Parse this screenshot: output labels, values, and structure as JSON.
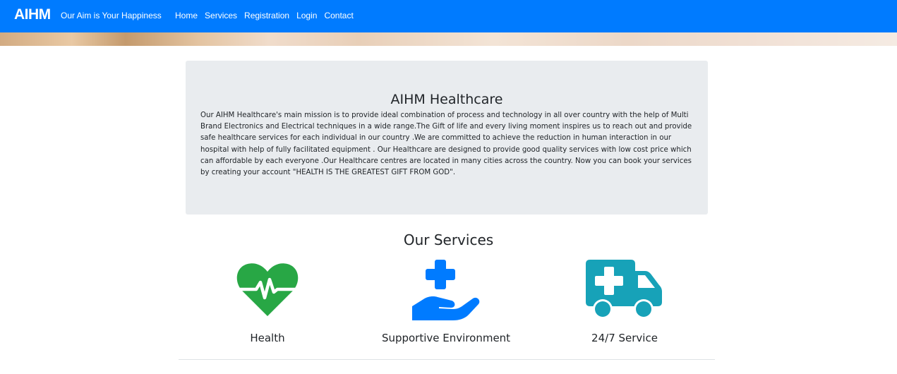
{
  "navbar": {
    "brand": "AIHM",
    "tagline": "Our Aim is Your Happiness",
    "links": [
      {
        "label": "Home"
      },
      {
        "label": "Services"
      },
      {
        "label": "Registration"
      },
      {
        "label": "Login"
      },
      {
        "label": "Contact"
      }
    ],
    "background_color": "#007bff"
  },
  "jumbotron": {
    "title": "AIHM Healthcare",
    "text": "Our AIHM Healthcare's main mission is to provide ideal combination of process and technology in all over country with the help of Multi Brand Electronics and Electrical techniques in a wide range.The Gift of life and every living moment inspires us to reach out and provide safe healthcare services for each individual in our country .We are committed to achieve the reduction in human interaction in our hospital with help of fully facilitated equipment . Our Healthcare are designed to provide good quality services with low cost price which can affordable by each everyone .Our Healthcare centres are located in many cities across the country. Now you can book your services by creating your account \"HEALTH IS THE GREATEST GIFT FROM GOD\".",
    "background_color": "#e9ecef"
  },
  "services": {
    "title": "Our Services",
    "items": [
      {
        "label": "Health",
        "icon": "heartbeat-icon",
        "color": "#28a745"
      },
      {
        "label": "Supportive Environment",
        "icon": "hand-holding-medical-icon",
        "color": "#007bff"
      },
      {
        "label": "24/7 Service",
        "icon": "ambulance-icon",
        "color": "#17a2b8"
      }
    ]
  }
}
